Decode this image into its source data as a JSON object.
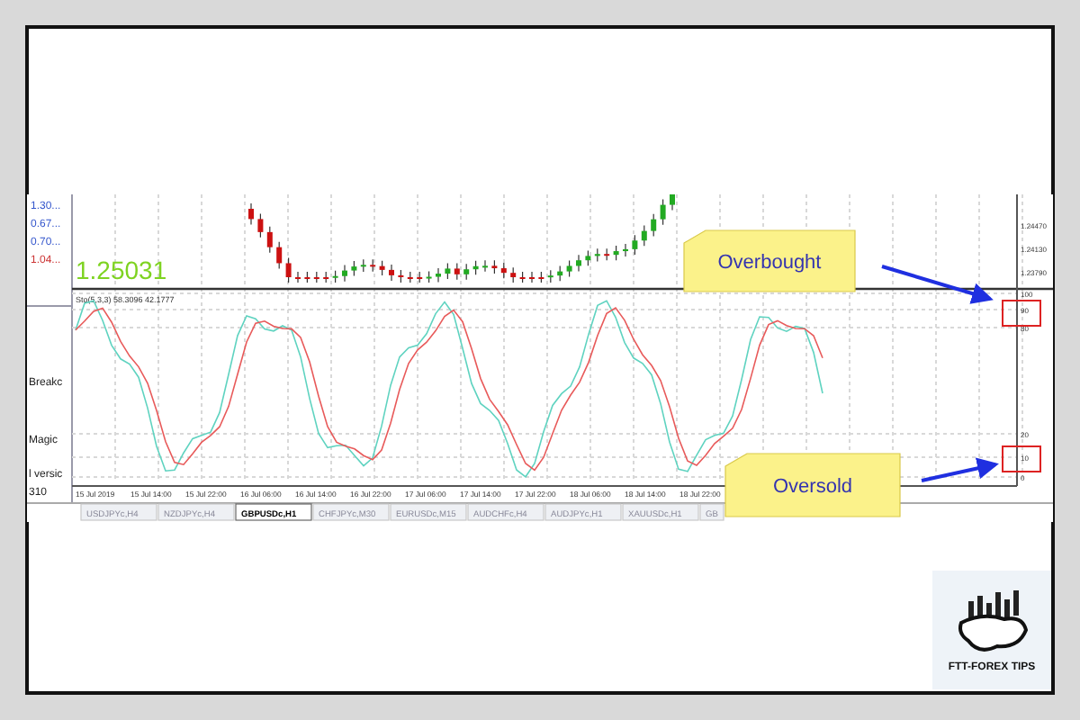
{
  "terminal": {
    "quotes": [
      {
        "text": "1.30...",
        "color": "#3355cc"
      },
      {
        "text": "0.67...",
        "color": "#3355cc"
      },
      {
        "text": "0.70...",
        "color": "#3355cc"
      },
      {
        "text": "1.04...",
        "color": "#cc3333"
      }
    ],
    "navigator": [
      "Breakc",
      "Magic",
      "l versic",
      "310"
    ]
  },
  "chart": {
    "current_price": "1.25031",
    "indicator_label": "Sto(5,3,3) 58.3096 42.1777",
    "price_axis": [
      "1.24470",
      "1.24130",
      "1.23790"
    ],
    "oscillator_axis": [
      "100",
      "90",
      "80",
      "20",
      "10",
      "0"
    ],
    "time_labels": [
      "15 Jul 2019",
      "15 Jul 14:00",
      "15 Jul 22:00",
      "16 Jul 06:00",
      "16 Jul 14:00",
      "16 Jul 22:00",
      "17 Jul 06:00",
      "17 Jul 14:00",
      "17 Jul 22:00",
      "18 Jul 06:00",
      "18 Jul 14:00",
      "18 Jul 22:00"
    ],
    "tabs": [
      {
        "label": "USDJPYc,H4",
        "selected": false
      },
      {
        "label": "NZDJPYc,H4",
        "selected": false
      },
      {
        "label": "GBPUSDc,H1",
        "selected": true
      },
      {
        "label": "CHFJPYc,M30",
        "selected": false
      },
      {
        "label": "EURUSDc,M15",
        "selected": false
      },
      {
        "label": "AUDCHFc,H4",
        "selected": false
      },
      {
        "label": "AUDJPYc,H1",
        "selected": false
      },
      {
        "label": "XAUUSDc,H1",
        "selected": false
      },
      {
        "label": "GB",
        "selected": false
      }
    ]
  },
  "callouts": [
    {
      "text": "Overbought",
      "kind": "top"
    },
    {
      "text": "Oversold",
      "kind": "bottom"
    }
  ],
  "logo": {
    "text": "FTT-FOREX TIPS"
  }
}
